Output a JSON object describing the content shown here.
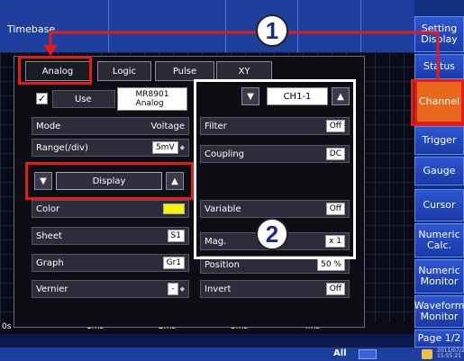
{
  "topbar": {
    "title": "Timebase"
  },
  "time_axis": {
    "ticks": [
      "0s",
      "1ms",
      "2ms",
      "3ms",
      "4ms"
    ]
  },
  "bottombar": {
    "all_label": "All",
    "date": "2011/07/22\n15:55:21"
  },
  "sidepanel": {
    "buttons": [
      {
        "label": "Setting Display",
        "active": false
      },
      {
        "label": "Status",
        "active": false
      },
      {
        "label": "Channel",
        "active": true
      },
      {
        "label": "Trigger",
        "active": false
      },
      {
        "label": "Gauge",
        "active": false
      },
      {
        "label": "Cursor",
        "active": false
      },
      {
        "label": "Numeric Calc.",
        "active": false
      },
      {
        "label": "Numeric Monitor",
        "active": false
      },
      {
        "label": "Waveform Monitor",
        "active": false
      },
      {
        "label": "Page 1/2",
        "active": false
      }
    ]
  },
  "tabs": [
    {
      "label": "Analog",
      "active": true
    },
    {
      "label": "Logic",
      "active": false
    },
    {
      "label": "Pulse",
      "active": false
    },
    {
      "label": "XY",
      "active": false
    }
  ],
  "left_panel": {
    "use_label": "Use",
    "use_checked": true,
    "module": "MR8901\nAnalog",
    "mode_label": "Mode",
    "mode_value": "Voltage",
    "range_label": "Range(/div)",
    "range_value": "5mV",
    "display_selector": "Display",
    "color_label": "Color",
    "color_value": "#f6f600",
    "sheet_label": "Sheet",
    "sheet_value": "S1",
    "graph_label": "Graph",
    "graph_value": "Gr1",
    "vernier_label": "Vernier",
    "vernier_value": "-"
  },
  "right_panel": {
    "channel": "CH1-1",
    "filter_label": "Filter",
    "filter_value": "Off",
    "coupling_label": "Coupling",
    "coupling_value": "DC",
    "variable_label": "Variable",
    "variable_value": "Off",
    "mag_label": "Mag.",
    "mag_value": "x 1",
    "position_label": "Position",
    "position_value": "50 %",
    "invert_label": "Invert",
    "invert_value": "Off"
  },
  "callouts": {
    "one": "1",
    "two": "2"
  }
}
